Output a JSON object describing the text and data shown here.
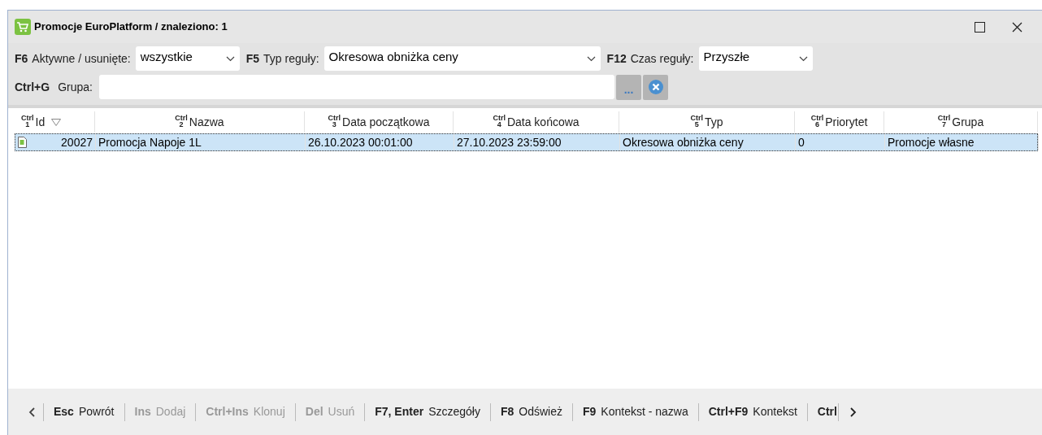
{
  "window": {
    "title": "Promocje EuroPlatform / znaleziono: 1"
  },
  "filters": [
    {
      "key": "F6",
      "label": "Aktywne / usunięte:",
      "value": "wszystkie"
    },
    {
      "key": "F5",
      "label": "Typ reguły:",
      "value": "Okresowa obniżka ceny"
    },
    {
      "key": "F12",
      "label": "Czas reguły:",
      "value": "Przyszłe"
    }
  ],
  "group_filter": {
    "key": "Ctrl+G",
    "label": "Grupa:",
    "browse": "..."
  },
  "table": {
    "columns": [
      {
        "mod": "Ctrl",
        "num": "1",
        "label": "Id",
        "sorted": true
      },
      {
        "mod": "Ctrl",
        "num": "2",
        "label": "Nazwa",
        "sorted": false
      },
      {
        "mod": "Ctrl",
        "num": "3",
        "label": "Data początkowa",
        "sorted": false
      },
      {
        "mod": "Ctrl",
        "num": "4",
        "label": "Data końcowa",
        "sorted": false
      },
      {
        "mod": "Ctrl",
        "num": "5",
        "label": "Typ",
        "sorted": false
      },
      {
        "mod": "Ctrl",
        "num": "6",
        "label": "Priorytet",
        "sorted": false
      },
      {
        "mod": "Ctrl",
        "num": "7",
        "label": "Grupa",
        "sorted": false
      }
    ],
    "rows": [
      {
        "selected": true,
        "cells": [
          "20027",
          "Promocja Napoje 1L",
          "26.10.2023 00:01:00",
          "27.10.2023 23:59:00",
          "Okresowa obniżka ceny",
          "0",
          "Promocje własne"
        ]
      }
    ]
  },
  "footer": [
    {
      "key": "Esc",
      "label": "Powrót",
      "disabled": false
    },
    {
      "key": "Ins",
      "label": "Dodaj",
      "disabled": true
    },
    {
      "key": "Ctrl+Ins",
      "label": "Klonuj",
      "disabled": true
    },
    {
      "key": "Del",
      "label": "Usuń",
      "disabled": true
    },
    {
      "key": "F7, Enter",
      "label": "Szczegóły",
      "disabled": false
    },
    {
      "key": "F8",
      "label": "Odśwież",
      "disabled": false
    },
    {
      "key": "F9",
      "label": "Kontekst - nazwa",
      "disabled": false
    },
    {
      "key": "Ctrl+F9",
      "label": "Kontekst",
      "disabled": false
    },
    {
      "key": "Ctrl",
      "disabled": false
    }
  ]
}
